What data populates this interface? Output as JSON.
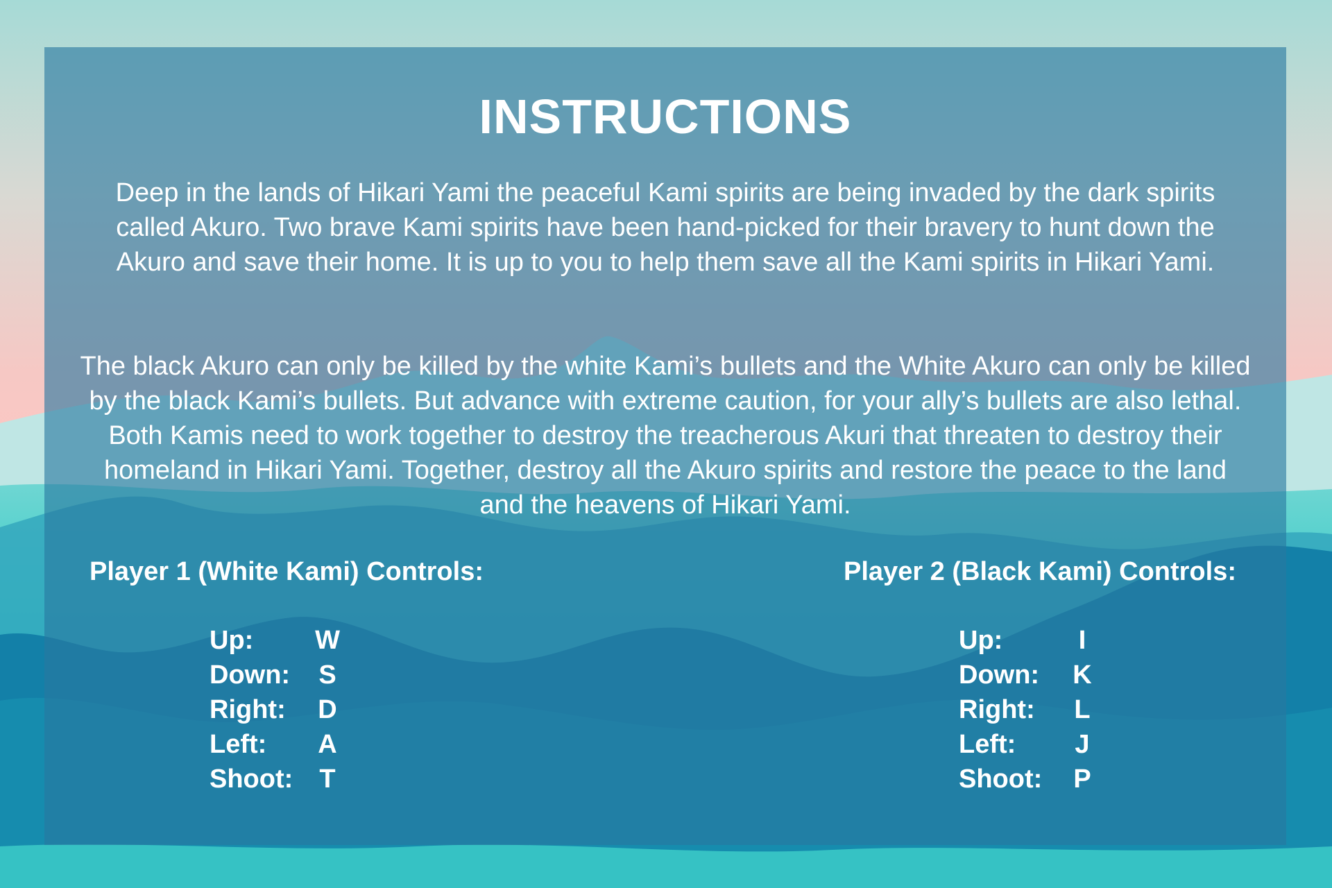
{
  "screen": {
    "title": "INSTRUCTIONS",
    "story": "Deep in the lands of Hikari Yami the peaceful Kami spirits are being invaded by the dark spirits called Akuro. Two brave Kami spirits have been hand-picked for their bravery to hunt down the Akuro and save their home. It is up to you to help them save all the Kami spirits in Hikari Yami.",
    "rules": "The black Akuro can only be killed by the white Kami’s bullets and the White Akuro can only be killed by the black Kami’s bullets. But advance with extreme caution, for your ally’s bullets are also lethal. Both Kamis need to work together to destroy the treacherous Akuri that threaten to destroy their homeland in Hikari Yami. Together, destroy all the Akuro spirits and restore the peace to the land and the heavens of Hikari Yami."
  },
  "player1": {
    "heading": "Player 1 (White Kami) Controls:",
    "controls": [
      {
        "action": "Up:",
        "key": "W"
      },
      {
        "action": "Down:",
        "key": "S"
      },
      {
        "action": "Right:",
        "key": "D"
      },
      {
        "action": "Left:",
        "key": "A"
      },
      {
        "action": "Shoot:",
        "key": "T"
      }
    ]
  },
  "player2": {
    "heading": "Player 2 (Black Kami) Controls:",
    "controls": [
      {
        "action": "Up:",
        "key": "I"
      },
      {
        "action": "Down:",
        "key": "K"
      },
      {
        "action": "Right:",
        "key": "L"
      },
      {
        "action": "Left:",
        "key": "J"
      },
      {
        "action": "Shoot:",
        "key": "P"
      }
    ]
  },
  "colors": {
    "sky_top": "#a9dcd9",
    "sky_pink": "#f7c6c4",
    "sea_teal": "#2fc8c6",
    "panel": "#2878a0",
    "text": "#ffffff"
  }
}
